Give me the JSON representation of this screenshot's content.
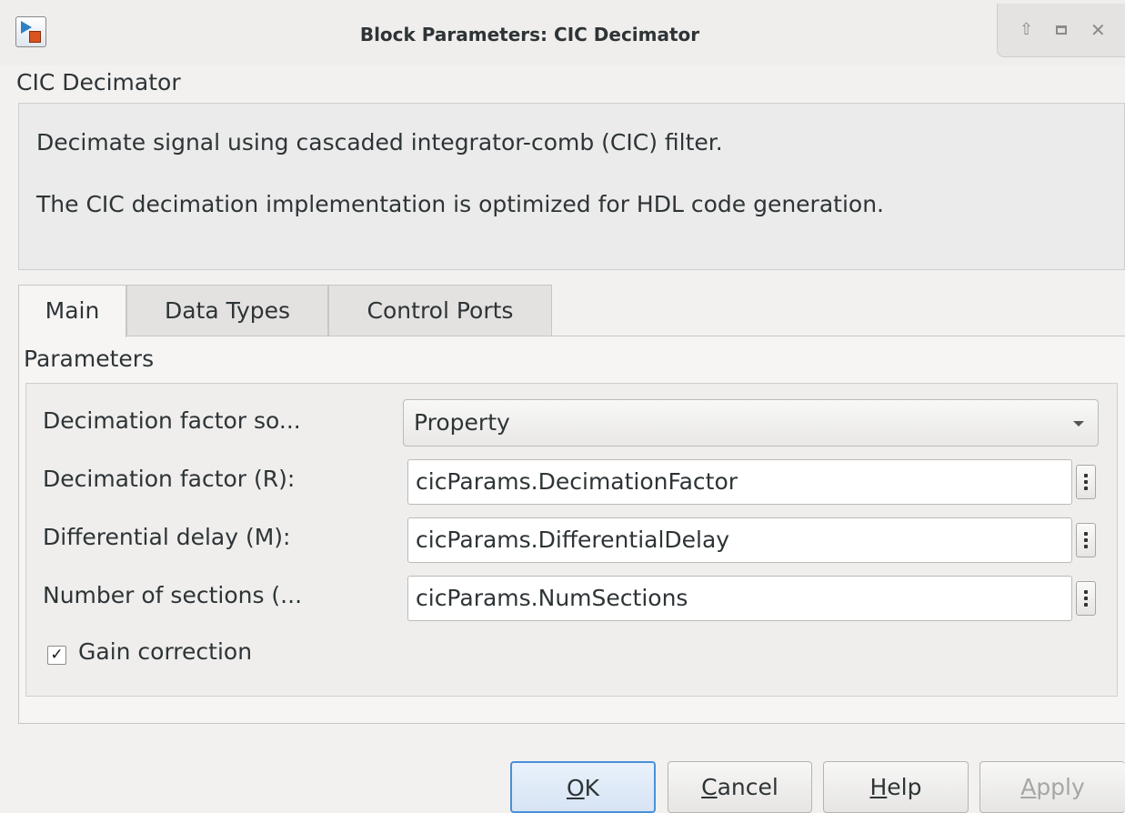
{
  "window": {
    "title": "Block Parameters: CIC Decimator",
    "controls": {
      "up_icon": "up-arrow-icon",
      "maximize_icon": "maximize-icon",
      "close_icon": "close-icon"
    }
  },
  "block": {
    "name": "CIC Decimator",
    "description": [
      "Decimate signal using cascaded integrator-comb (CIC) filter.",
      "The CIC decimation implementation is optimized for HDL code generation."
    ]
  },
  "tabs": [
    {
      "label": "Main",
      "active": true
    },
    {
      "label": "Data Types",
      "active": false
    },
    {
      "label": "Control Ports",
      "active": false
    }
  ],
  "parameters": {
    "group_label": "Parameters",
    "decimation_source": {
      "label": "Decimation factor so...",
      "value": "Property"
    },
    "decimation_factor": {
      "label": "Decimation factor (R):",
      "value": "cicParams.DecimationFactor"
    },
    "differential_delay": {
      "label": "Differential delay (M):",
      "value": "cicParams.DifferentialDelay"
    },
    "num_sections": {
      "label": "Number of sections (...",
      "value": "cicParams.NumSections"
    },
    "gain_correction": {
      "label": "Gain correction",
      "checked": true,
      "check_mark": "✓"
    }
  },
  "buttons": {
    "ok_mnemonic": "O",
    "ok_rest": "K",
    "cancel_mnemonic": "C",
    "cancel_rest": "ancel",
    "help_mnemonic": "H",
    "help_rest": "elp",
    "apply_mnemonic": "A",
    "apply_rest": "pply",
    "apply_enabled": false
  },
  "colors": {
    "accent": "#4a90d9",
    "disabled_text": "#a6a6a6"
  }
}
